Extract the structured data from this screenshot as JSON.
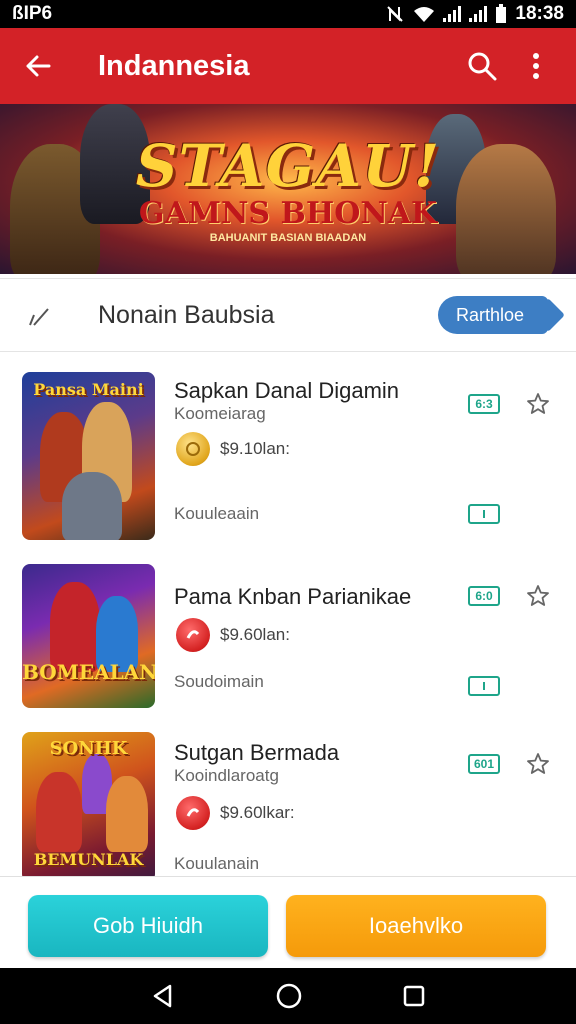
{
  "status": {
    "left": "ßIP6",
    "time": "18:38"
  },
  "app_bar": {
    "title": "Indannesia"
  },
  "banner": {
    "title": "STAGAU!",
    "subtitle": "GAMNS BHONAK",
    "caption": "BAHUANIT BASIAN BIAADAN"
  },
  "section": {
    "title": "Nonain Baubsia",
    "action_label": "Rarthloe"
  },
  "items": [
    {
      "name": "Sapkan Danal Digamin",
      "sub": "Koomeiarag",
      "price": "$9.10lan:",
      "footer": "Kouuleaain",
      "badge": "6:3",
      "coin": "gold",
      "thumb_title": "Pansa Maini"
    },
    {
      "name": "Pama Knban Parianikae",
      "sub": "",
      "price": "$9.60lan:",
      "footer": "Soudoimain",
      "badge": "6:0",
      "coin": "red",
      "thumb_title": "BOMEALAN"
    },
    {
      "name": "Sutgan Bermada",
      "sub": "Kooindlaroatg",
      "price": "$9.60lkar:",
      "footer": "Kouulanain",
      "badge": "601",
      "coin": "red",
      "thumb_title": "SONHK"
    }
  ],
  "thumb_captions": {
    "item3_bottom": "BEMUNLAK"
  },
  "buttons": {
    "left": "Gob Hiuidh",
    "right": "Ioaehvlko"
  },
  "colors": {
    "app_bar": "#d32227",
    "accent_blue": "#3d7ec4",
    "badge_green": "#1ea58a",
    "btn_cyan": "#1fc3cc",
    "btn_orange": "#f7a412"
  }
}
